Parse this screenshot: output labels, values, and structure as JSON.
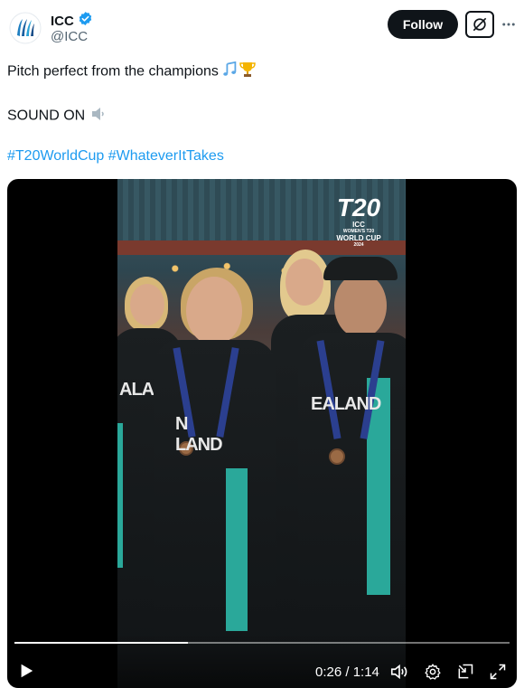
{
  "author": {
    "name": "ICC",
    "handle": "@ICC",
    "verified": true,
    "verified_color": "#1d9bf0"
  },
  "actions": {
    "follow_label": "Follow"
  },
  "tweet": {
    "line1": "Pitch perfect from the champions",
    "line1_emojis": [
      "musical-notes",
      "trophy"
    ],
    "line2": "SOUND ON",
    "line2_emoji": "speaker-low-volume",
    "hashtags": "#T20WorldCup #WhateverItTakes",
    "hashtag_color": "#1d9bf0"
  },
  "video": {
    "logo": {
      "t20": "T20",
      "icc": "ICC",
      "sub": "WOMEN'S T20",
      "cup": "WORLD CUP",
      "year": "2024"
    },
    "jersey_text_left": "ALAND",
    "jersey_text_mid": "N  LAND",
    "jersey_text_right": "EALAND",
    "time": "0:26 / 1:14",
    "progress_fraction": 0.35
  }
}
